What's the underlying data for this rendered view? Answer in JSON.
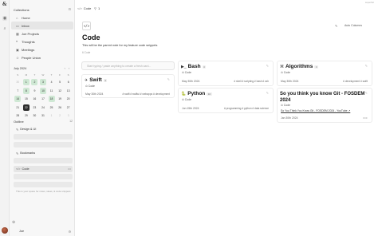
{
  "app": {
    "window_title": "superlist"
  },
  "rail": {
    "items": [
      {
        "name": "home-rail-icon",
        "glyph": "◉"
      },
      {
        "name": "sidebar-toggle-icon",
        "glyph": "▤"
      },
      {
        "name": "search-rail-icon",
        "glyph": "⌕"
      }
    ]
  },
  "sidebar": {
    "title": "Collections",
    "nav": [
      {
        "label": "Home",
        "icon": "home-icon",
        "glyph": "⌂",
        "count": ""
      },
      {
        "label": "Inbox",
        "icon": "inbox-icon",
        "glyph": "▭",
        "count": ""
      },
      {
        "label": "Joe Projects",
        "icon": "folder-icon",
        "glyph": "▦",
        "count": ""
      },
      {
        "label": "Thoughts",
        "icon": "thought-icon",
        "glyph": "❝",
        "count": ""
      },
      {
        "label": "Meetings",
        "icon": "calendar-icon",
        "glyph": "▣",
        "count": ""
      },
      {
        "label": "People Union",
        "icon": "people-icon",
        "glyph": "☺",
        "count": ""
      }
    ],
    "calendar": {
      "month": "July 2024",
      "dow": [
        "S",
        "M",
        "T",
        "W",
        "T",
        "F",
        "S"
      ],
      "weeks": [
        [
          {
            "d": "30",
            "s": "dim"
          },
          {
            "d": "1",
            "s": "hl"
          },
          {
            "d": "2",
            "s": "hl"
          },
          {
            "d": "3",
            "s": "hl"
          },
          {
            "d": "4",
            "s": ""
          },
          {
            "d": "5",
            "s": ""
          },
          {
            "d": "6",
            "s": ""
          }
        ],
        [
          {
            "d": "7",
            "s": ""
          },
          {
            "d": "8",
            "s": "hl"
          },
          {
            "d": "9",
            "s": ""
          },
          {
            "d": "10",
            "s": "hl"
          },
          {
            "d": "11",
            "s": ""
          },
          {
            "d": "12",
            "s": ""
          },
          {
            "d": "13",
            "s": ""
          }
        ],
        [
          {
            "d": "14",
            "s": "hl"
          },
          {
            "d": "15",
            "s": ""
          },
          {
            "d": "16",
            "s": ""
          },
          {
            "d": "17",
            "s": ""
          },
          {
            "d": "18",
            "s": "hl"
          },
          {
            "d": "19",
            "s": ""
          },
          {
            "d": "20",
            "s": ""
          }
        ],
        [
          {
            "d": "21",
            "s": ""
          },
          {
            "d": "22",
            "s": "today"
          },
          {
            "d": "23",
            "s": ""
          },
          {
            "d": "24",
            "s": ""
          },
          {
            "d": "25",
            "s": ""
          },
          {
            "d": "26",
            "s": ""
          },
          {
            "d": "27",
            "s": ""
          }
        ],
        [
          {
            "d": "28",
            "s": ""
          },
          {
            "d": "29",
            "s": ""
          },
          {
            "d": "30",
            "s": ""
          },
          {
            "d": "31",
            "s": ""
          },
          {
            "d": "1",
            "s": "dim"
          },
          {
            "d": "2",
            "s": "dim"
          },
          {
            "d": "3",
            "s": "dim"
          }
        ]
      ]
    },
    "outline": {
      "title": "Outline",
      "count": "12",
      "items": [
        {
          "label": "Design & UI",
          "glyph": "✎"
        },
        {
          "label": "Bookmarks",
          "glyph": "✎"
        },
        {
          "label": "Code",
          "glyph": "</>"
        }
      ],
      "note": "This is your space for notes, ideas, & code snippets"
    },
    "footer_label": "Joe"
  },
  "topbar": {
    "tabs": [
      {
        "label": "Code",
        "glyph": "</>"
      },
      {
        "label": "1",
        "glyph": "⚲"
      }
    ]
  },
  "main": {
    "badge": "</>",
    "title": "Code",
    "subtitle": "This will be the parent note for my feature code snippets",
    "count": "6 Code",
    "sort_label": "Auto Columns",
    "input_placeholder": "Start typing / paste anything to create a fresh card...",
    "cards": [
      {
        "key": "swift",
        "title": "Swift",
        "icon": "swift-icon",
        "glyph": "✈",
        "pill": "4",
        "tag": "Code",
        "date": "May 30th 2024",
        "tags": "# swift  # swiftui  # webapps  # development"
      },
      {
        "key": "bash",
        "title": "Bash",
        "icon": "terminal-icon",
        "glyph": "▶_",
        "pill": "4",
        "tag": "Code",
        "date": "May 30th 2024",
        "tags": "# shell  # scripting  # bash  # zsh"
      },
      {
        "key": "python",
        "title": "Python",
        "icon": "python-icon",
        "glyph": "🐍",
        "pill": "10",
        "tag": "Code",
        "date": "Jun 15th 2024",
        "tags": "# programming  # python  # data science"
      },
      {
        "key": "algorithms",
        "title": "Algorithms",
        "icon": "algorithm-icon",
        "glyph": "⌘",
        "pill": "4",
        "tag": "Code",
        "date": "May 30th 2024",
        "tags": "# development  # swift"
      },
      {
        "key": "fosdem",
        "title": "So you think you know Git - FOSDEM 2024",
        "icon": "",
        "glyph": "",
        "pill": "",
        "tag": "Code",
        "date": "Jan 30th 2024",
        "link": "So You Think You Know Git - FOSDEM 2024 - YouTube ↗",
        "more": "•••"
      }
    ]
  }
}
